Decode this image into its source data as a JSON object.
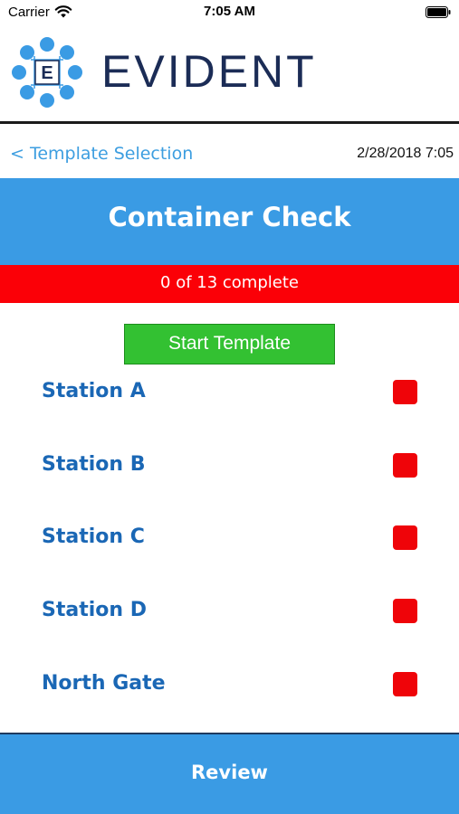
{
  "status_bar": {
    "carrier": "Carrier",
    "time": "7:05 AM",
    "icons": [
      "wifi-icon",
      "battery-icon"
    ]
  },
  "header": {
    "brand": "EVIDENT",
    "logo_letter": "E",
    "brand_color": "#1b2c56",
    "logo_color": "#3a9be4"
  },
  "nav": {
    "back_label": "< Template Selection",
    "datetime": "2/28/2018 7:05"
  },
  "template": {
    "title": "Container Check",
    "progress": "0 of 13 complete",
    "completed": 0,
    "total": 13,
    "start_label": "Start Template"
  },
  "stations": [
    {
      "label": "Station A",
      "status": "incomplete"
    },
    {
      "label": "Station B",
      "status": "incomplete"
    },
    {
      "label": "Station C",
      "status": "incomplete"
    },
    {
      "label": "Station D",
      "status": "incomplete"
    },
    {
      "label": "North Gate",
      "status": "incomplete"
    }
  ],
  "footer": {
    "review_label": "Review"
  },
  "colors": {
    "accent_blue": "#3a9be4",
    "progress_red": "#fb0007",
    "start_green": "#33c132",
    "station_text": "#1a67b5",
    "incomplete_indicator": "#ef0409"
  }
}
